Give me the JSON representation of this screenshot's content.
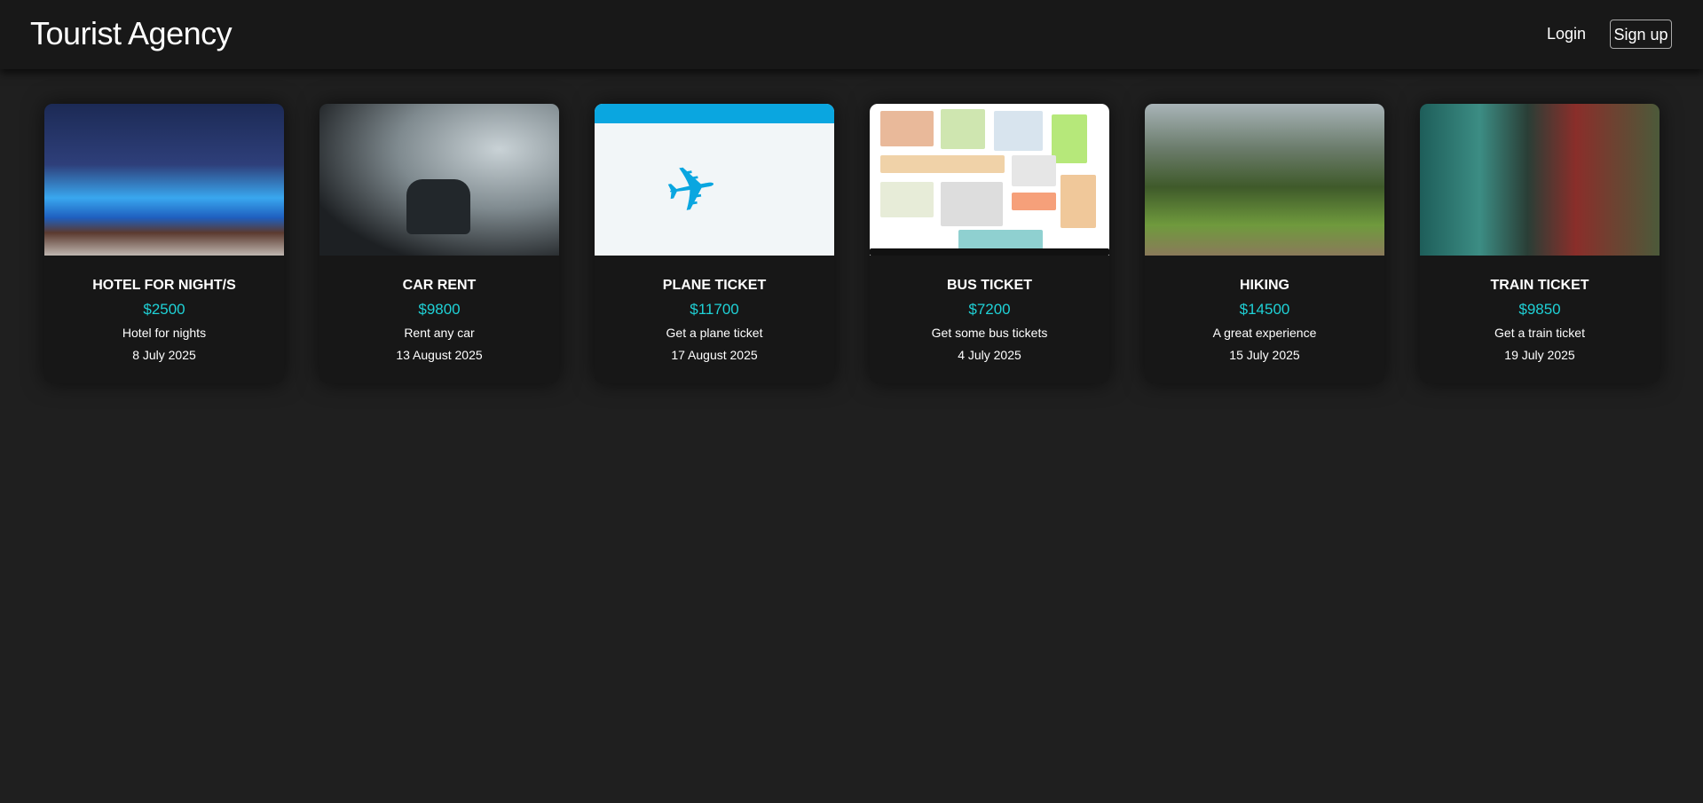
{
  "header": {
    "brand": "Tourist Agency",
    "login": "Login",
    "signup": "Sign up"
  },
  "cards": [
    {
      "title": "HOTEL FOR NIGHT/S",
      "price": "$2500",
      "description": "Hotel for nights",
      "date": "8 July 2025"
    },
    {
      "title": "CAR RENT",
      "price": "$9800",
      "description": "Rent any car",
      "date": "13 August 2025"
    },
    {
      "title": "PLANE TICKET",
      "price": "$11700",
      "description": "Get a plane ticket",
      "date": "17 August 2025"
    },
    {
      "title": "BUS TICKET",
      "price": "$7200",
      "description": "Get some bus tickets",
      "date": "4 July 2025"
    },
    {
      "title": "HIKING",
      "price": "$14500",
      "description": "A great experience",
      "date": "15 July 2025"
    },
    {
      "title": "TRAIN TICKET",
      "price": "$9850",
      "description": "Get a train ticket",
      "date": "19 July 2025"
    }
  ],
  "colors": {
    "accent": "#1fd1d6",
    "background": "#1f1f1f",
    "header": "#181818",
    "card": "#171717"
  }
}
